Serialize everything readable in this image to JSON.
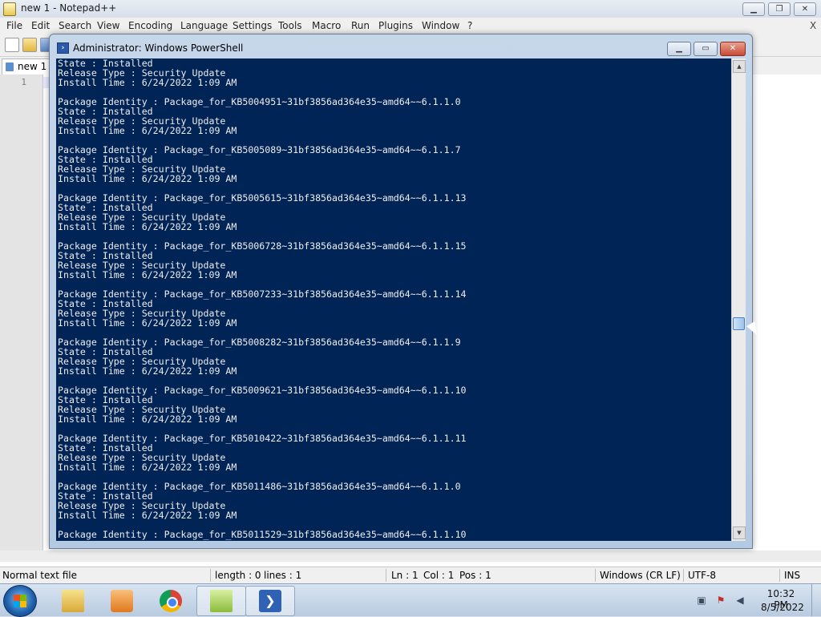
{
  "notepad": {
    "title": "new 1 - Notepad++",
    "window_controls": {
      "minimize": "▁",
      "maximize": "❐",
      "close": "✕"
    },
    "menu": [
      "File",
      "Edit",
      "Search",
      "View",
      "Encoding",
      "Language",
      "Settings",
      "Tools",
      "Macro",
      "Run",
      "Plugins",
      "Window",
      "?"
    ],
    "menu_close": "X",
    "tab_label": "new 1",
    "line_number": "1",
    "status": {
      "doc_type": "Normal text file",
      "length": "length : 0",
      "lines": "lines : 1",
      "ln": "Ln : 1",
      "col": "Col : 1",
      "pos": "Pos : 1",
      "eol": "Windows (CR LF)",
      "encoding": "UTF-8",
      "mode": "INS"
    }
  },
  "powershell": {
    "title": "Administrator: Windows PowerShell",
    "window_controls": {
      "minimize": "▁",
      "maximize": "▭",
      "close": "✕"
    },
    "lines": [
      "State : Installed",
      "Release Type : Security Update",
      "Install Time : 6/24/2022 1:09 AM",
      "",
      "Package Identity : Package_for_KB5004951~31bf3856ad364e35~amd64~~6.1.1.0",
      "State : Installed",
      "Release Type : Security Update",
      "Install Time : 6/24/2022 1:09 AM",
      "",
      "Package Identity : Package_for_KB5005089~31bf3856ad364e35~amd64~~6.1.1.7",
      "State : Installed",
      "Release Type : Security Update",
      "Install Time : 6/24/2022 1:09 AM",
      "",
      "Package Identity : Package_for_KB5005615~31bf3856ad364e35~amd64~~6.1.1.13",
      "State : Installed",
      "Release Type : Security Update",
      "Install Time : 6/24/2022 1:09 AM",
      "",
      "Package Identity : Package_for_KB5006728~31bf3856ad364e35~amd64~~6.1.1.15",
      "State : Installed",
      "Release Type : Security Update",
      "Install Time : 6/24/2022 1:09 AM",
      "",
      "Package Identity : Package_for_KB5007233~31bf3856ad364e35~amd64~~6.1.1.14",
      "State : Installed",
      "Release Type : Security Update",
      "Install Time : 6/24/2022 1:09 AM",
      "",
      "Package Identity : Package_for_KB5008282~31bf3856ad364e35~amd64~~6.1.1.9",
      "State : Installed",
      "Release Type : Security Update",
      "Install Time : 6/24/2022 1:09 AM",
      "",
      "Package Identity : Package_for_KB5009621~31bf3856ad364e35~amd64~~6.1.1.10",
      "State : Installed",
      "Release Type : Security Update",
      "Install Time : 6/24/2022 1:09 AM",
      "",
      "Package Identity : Package_for_KB5010422~31bf3856ad364e35~amd64~~6.1.1.11",
      "State : Installed",
      "Release Type : Security Update",
      "Install Time : 6/24/2022 1:09 AM",
      "",
      "Package Identity : Package_for_KB5011486~31bf3856ad364e35~amd64~~6.1.1.0",
      "State : Installed",
      "Release Type : Security Update",
      "Install Time : 6/24/2022 1:09 AM",
      "",
      "Package Identity : Package_for_KB5011529~31bf3856ad364e35~amd64~~6.1.1.10"
    ],
    "console_bg": "#012456",
    "console_fg": "#eeedf0"
  },
  "taskbar": {
    "items": [
      "windows-explorer",
      "media-player",
      "chrome",
      "notepad-plus-plus",
      "powershell"
    ],
    "powershell_glyph": "❯",
    "clock_time": "10:32 PM",
    "clock_date": "8/5/2022",
    "tray_icons": [
      "network-icon",
      "action-center-icon",
      "volume-icon"
    ]
  }
}
